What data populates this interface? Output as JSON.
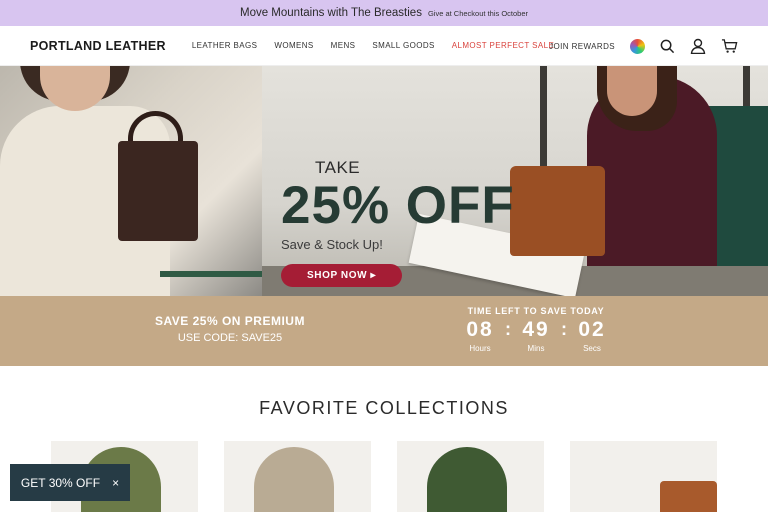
{
  "announcement": {
    "main": "Move Mountains with The Breasties",
    "sub": "Give at Checkout this October"
  },
  "brand": "PORTLAND LEATHER",
  "nav": {
    "items": [
      "LEATHER BAGS",
      "WOMENS",
      "MENS",
      "SMALL GOODS",
      "ALMOST PERFECT SALE"
    ],
    "join": "JOIN REWARDS"
  },
  "hero": {
    "take": "TAKE",
    "off": "25% OFF",
    "sub": "Save & Stock Up!",
    "cta": "SHOP NOW ▸"
  },
  "promo": {
    "line1": "SAVE 25% ON PREMIUM",
    "line2": "USE CODE: SAVE25"
  },
  "timer": {
    "title": "TIME LEFT TO SAVE TODAY",
    "hours": "08",
    "minutes": "49",
    "seconds": "02",
    "hours_label": "Hours",
    "minutes_label": "Mins",
    "seconds_label": "Secs"
  },
  "collections": {
    "title": "FAVORITE COLLECTIONS"
  },
  "toast": {
    "label": "GET 30% OFF",
    "close": "×"
  },
  "colors": {
    "announce_bg": "#d8c5f0",
    "sale": "#d9433d",
    "cta": "#a51d35",
    "promo_bg": "#c4a987",
    "toast_bg": "#263b45",
    "headline": "#263b34"
  },
  "icons": [
    "globe-icon",
    "search-icon",
    "account-icon",
    "cart-icon",
    "close-icon"
  ]
}
